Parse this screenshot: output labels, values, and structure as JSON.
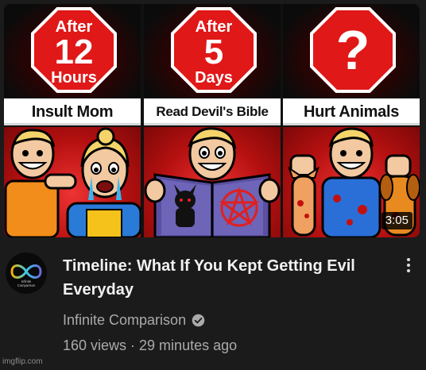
{
  "thumbnail": {
    "panels": [
      {
        "top_line": "After",
        "big": "12",
        "bottom_line": "Hours",
        "caption": "Insult Mom"
      },
      {
        "top_line": "After",
        "big": "5",
        "bottom_line": "Days",
        "caption": "Read Devil's Bible"
      },
      {
        "top_line": "",
        "big": "?",
        "bottom_line": "",
        "caption": "Hurt Animals"
      }
    ],
    "duration": "3:05"
  },
  "avatar": {
    "line1": "Infinite",
    "line2": "Comparison"
  },
  "video": {
    "title": "Timeline: What If You Kept Getting Evil Everyday",
    "channel": "Infinite Comparison",
    "stats": "160 views · 29 minutes ago"
  },
  "icons": {
    "verified": "verified-check-icon",
    "more": "more-vert-icon"
  },
  "colors": {
    "background": "#1b1b1b",
    "accent_red": "#e01818",
    "title": "#f1f1f1",
    "meta": "#aaaaaa"
  },
  "watermark": "imgflip.com"
}
